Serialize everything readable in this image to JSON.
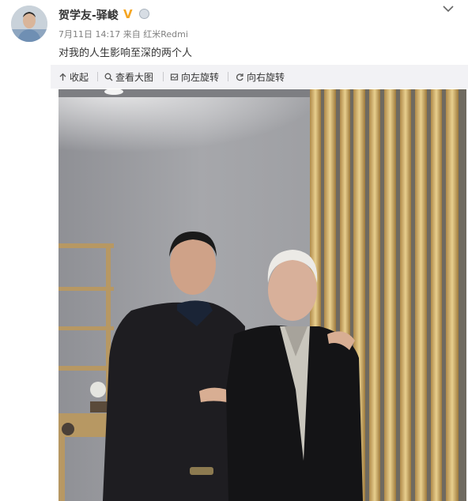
{
  "post": {
    "username": "贺学友-驿峻",
    "verified_badge": "V",
    "medal_icon": "medal-icon",
    "date": "7月11日 14:17",
    "source_prefix": "来自",
    "source": "红米Redmi",
    "text": "对我的人生影响至深的两个人"
  },
  "toolbar": {
    "collapse_label": "收起",
    "view_large_label": "查看大图",
    "rotate_left_label": "向左旋转",
    "rotate_right_label": "向右旋转"
  },
  "icons": [
    "chevron-down-icon",
    "collapse-up-icon",
    "zoom-icon",
    "photo-icon",
    "rotate-left-icon",
    "rotate-right-icon"
  ],
  "colors": {
    "verified": "#f5a623",
    "toolbar_bg": "#f2f2f5",
    "meta_text": "#808080"
  }
}
